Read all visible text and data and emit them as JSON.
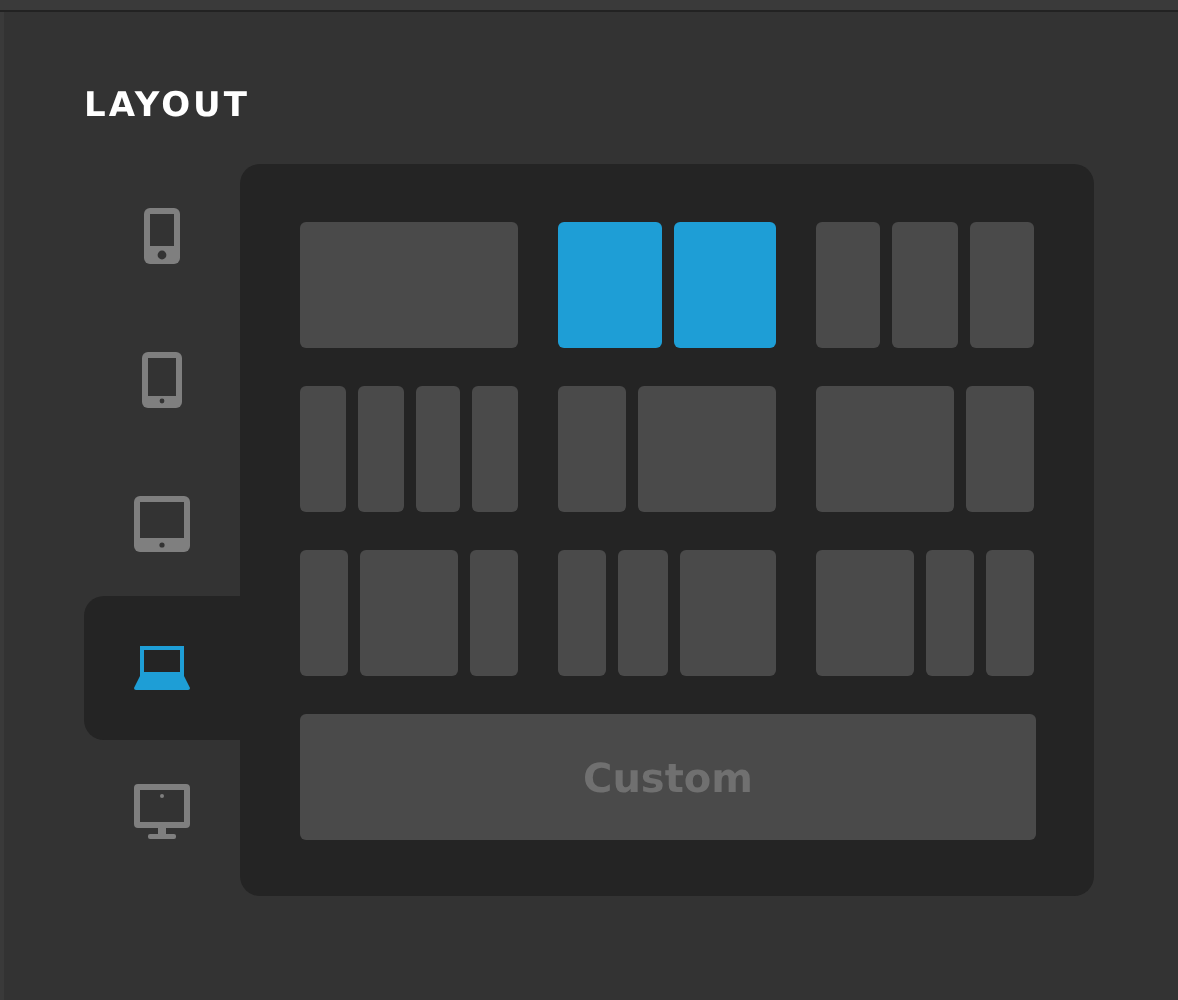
{
  "section": {
    "title": "LAYOUT"
  },
  "devices": [
    {
      "kind": "phone",
      "selected": false
    },
    {
      "kind": "tablet",
      "selected": false
    },
    {
      "kind": "tablet-landscape",
      "selected": false
    },
    {
      "kind": "laptop",
      "selected": true
    },
    {
      "kind": "desktop",
      "selected": false
    }
  ],
  "layouts": [
    {
      "kind": "full",
      "selected": false
    },
    {
      "kind": "halves",
      "selected": true
    },
    {
      "kind": "thirds",
      "selected": false
    },
    {
      "kind": "quarters",
      "selected": false
    },
    {
      "kind": "narrow-wide",
      "selected": false
    },
    {
      "kind": "wide-narrow",
      "selected": false
    },
    {
      "kind": "narrow-wide-narrow",
      "selected": false
    },
    {
      "kind": "narrow-narrow-wide",
      "selected": false
    },
    {
      "kind": "wide-narrow-narrow",
      "selected": false
    }
  ],
  "custom_button": {
    "label": "Custom"
  }
}
